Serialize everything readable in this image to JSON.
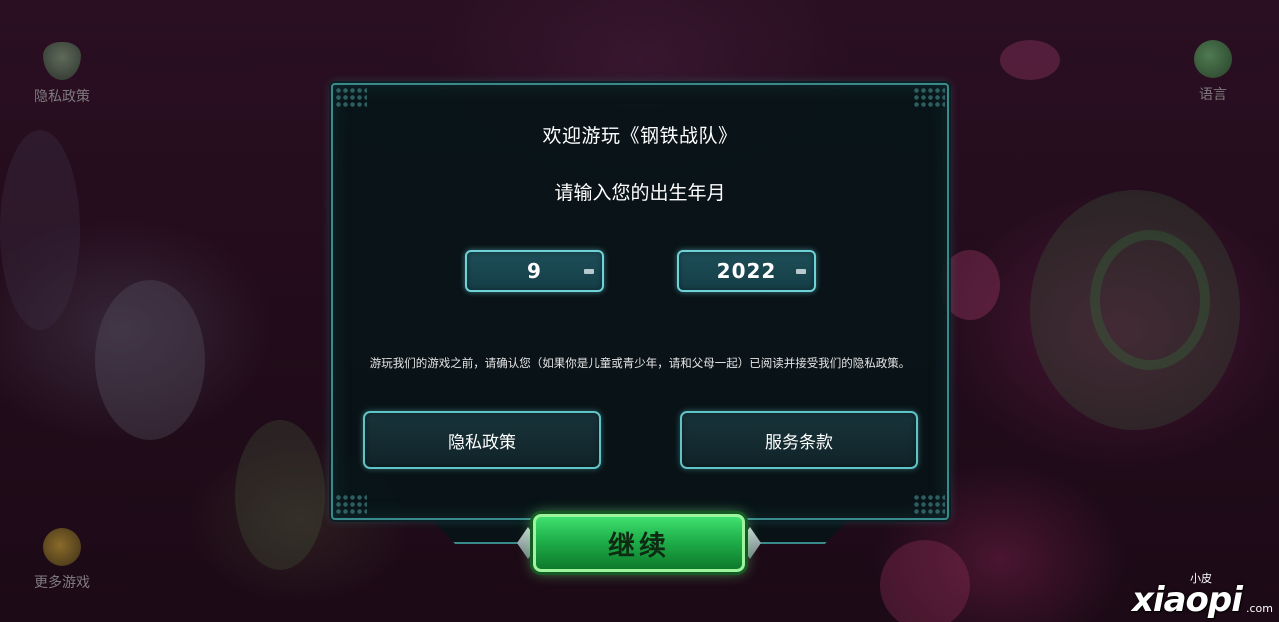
{
  "side_menu": {
    "privacy_label": "隐私政策",
    "language_label": "语言",
    "more_games_label": "更多游戏"
  },
  "dialog": {
    "title": "欢迎游玩《钢铁战队》",
    "prompt": "请输入您的出生年月",
    "month_value": "9",
    "year_value": "2022",
    "notice": "游玩我们的游戏之前，请确认您（如果你是儿童或青少年，请和父母一起）已阅读并接受我们的隐私政策。",
    "privacy_button": "隐私政策",
    "terms_button": "服务条款",
    "continue_button": "继续"
  },
  "watermark": {
    "small": "小皮",
    "main": "xiaopi",
    "suffix": ".com"
  },
  "colors": {
    "frame": "#3a8a8c",
    "selector_border": "#6fd2d8",
    "continue_green": "#2fc95a"
  },
  "icons": {
    "privacy": "shield-icon",
    "language": "globe-icon",
    "more_games": "game-controller-icon",
    "dropdown": "dropdown-arrow-icon"
  }
}
